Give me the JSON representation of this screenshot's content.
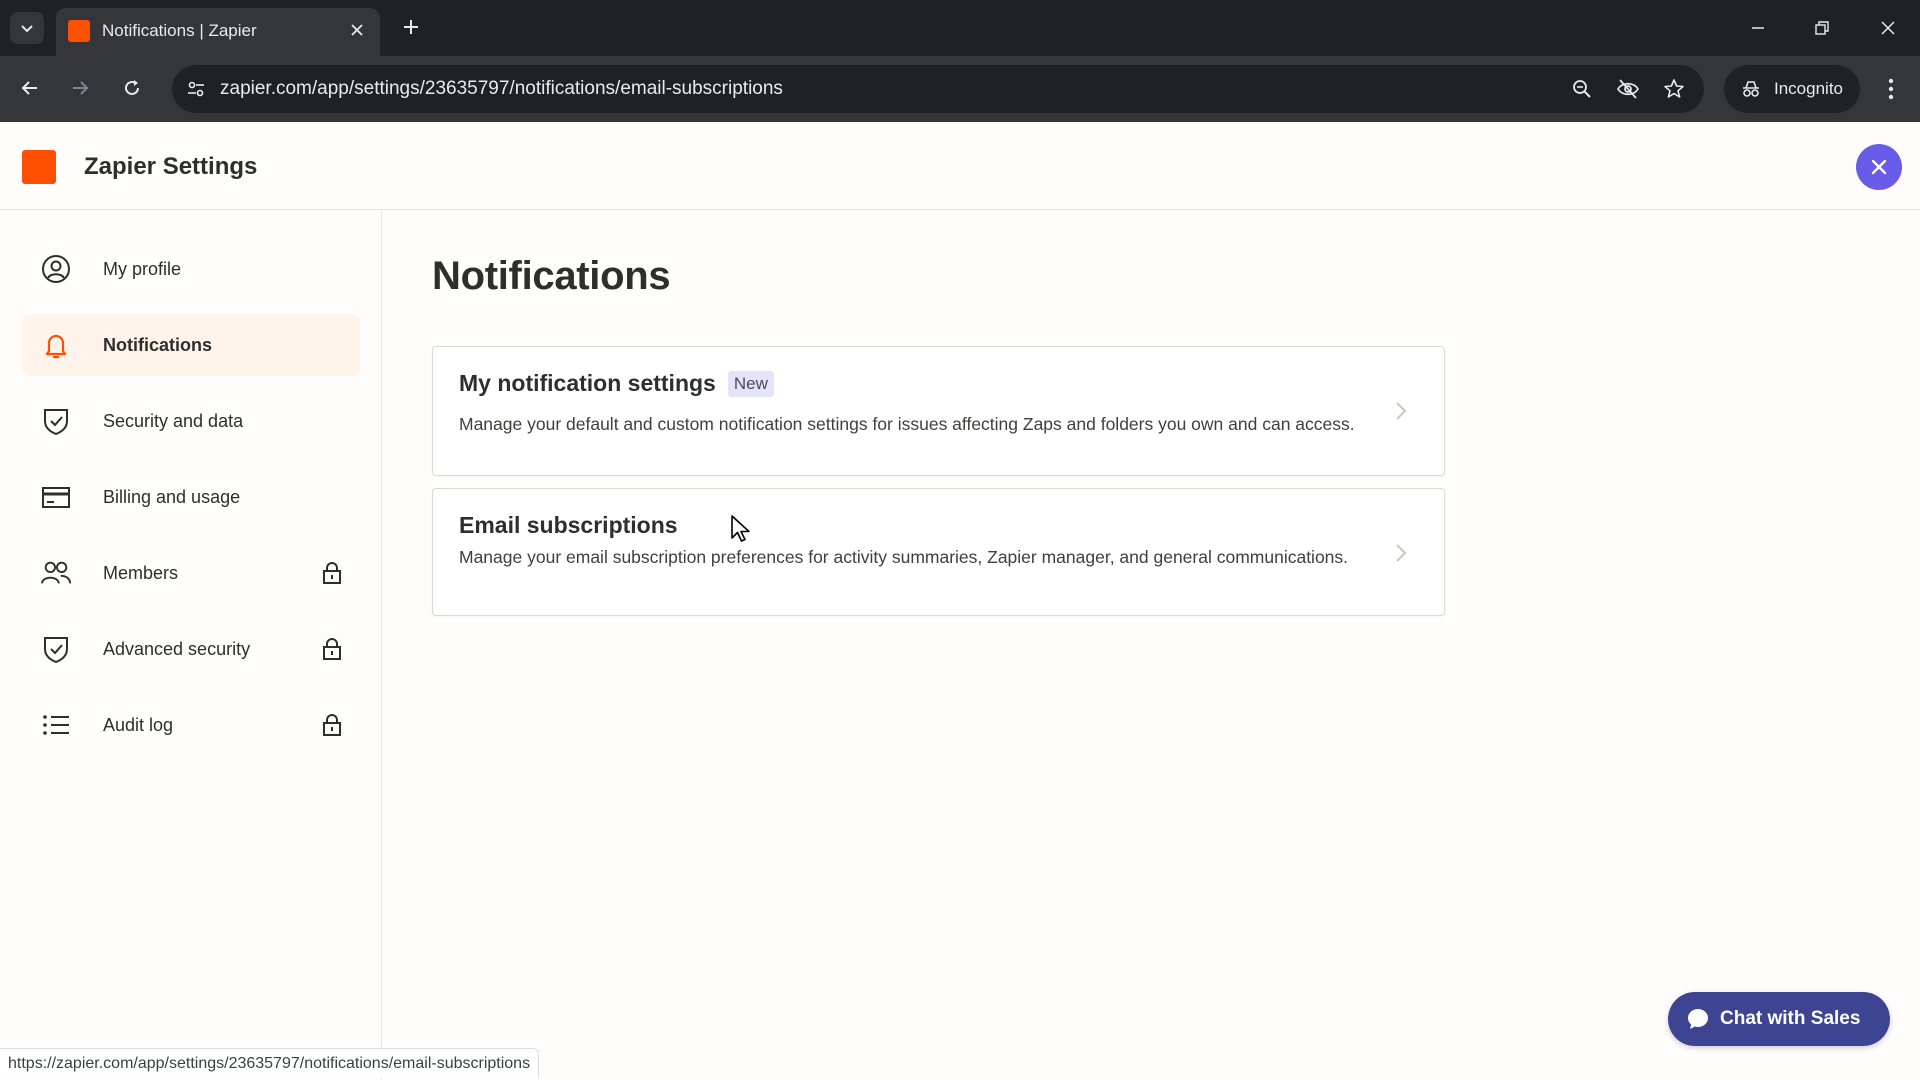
{
  "browser": {
    "tab_title": "Notifications | Zapier",
    "url": "zapier.com/app/settings/23635797/notifications/email-subscriptions",
    "incognito_label": "Incognito",
    "status_url": "https://zapier.com/app/settings/23635797/notifications/email-subscriptions"
  },
  "header": {
    "title": "Zapier Settings",
    "brand_color": "#ff4f00",
    "close_button_color": "#695be8"
  },
  "sidebar": {
    "items": [
      {
        "label": "My profile",
        "icon": "user-circle-icon",
        "active": false,
        "locked": false
      },
      {
        "label": "Notifications",
        "icon": "bell-icon",
        "active": true,
        "locked": false
      },
      {
        "label": "Security and data",
        "icon": "shield-check-icon",
        "active": false,
        "locked": false
      },
      {
        "label": "Billing and usage",
        "icon": "credit-card-icon",
        "active": false,
        "locked": false
      },
      {
        "label": "Members",
        "icon": "users-icon",
        "active": false,
        "locked": true
      },
      {
        "label": "Advanced security",
        "icon": "shield-check-icon",
        "active": false,
        "locked": true
      },
      {
        "label": "Audit log",
        "icon": "list-icon",
        "active": false,
        "locked": true
      }
    ]
  },
  "main": {
    "title": "Notifications",
    "cards": [
      {
        "title": "My notification settings",
        "badge": "New",
        "description": "Manage your default and custom notification settings for issues affecting Zaps and folders you own and can access."
      },
      {
        "title": "Email subscriptions",
        "description": "Manage your email subscription preferences for activity summaries, Zapier manager, and general communications."
      }
    ]
  },
  "chat": {
    "label": "Chat with Sales",
    "color": "#3d4592"
  }
}
